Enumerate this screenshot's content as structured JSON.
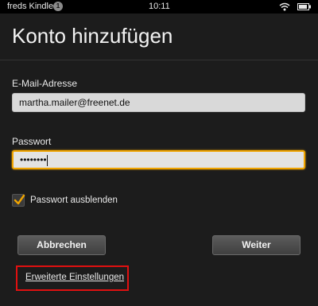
{
  "status_bar": {
    "device_name": "freds Kindle",
    "notification_count": "1",
    "time": "10:11"
  },
  "page": {
    "title": "Konto hinzufügen"
  },
  "form": {
    "email_label": "E-Mail-Adresse",
    "email_value": "martha.mailer@freenet.de",
    "password_label": "Passwort",
    "password_value": "••••••••",
    "hide_password_label": "Passwort ausblenden",
    "hide_password_checked": true
  },
  "buttons": {
    "cancel_label": "Abbrechen",
    "next_label": "Weiter"
  },
  "links": {
    "advanced_settings": "Erweiterte Einstellungen"
  },
  "colors": {
    "background": "#1c1c1c",
    "focus_accent": "#f0a400",
    "checkmark": "#f0a400",
    "highlight_box": "#e01010"
  },
  "icons": [
    "wifi-icon",
    "battery-icon",
    "checkmark-icon"
  ]
}
